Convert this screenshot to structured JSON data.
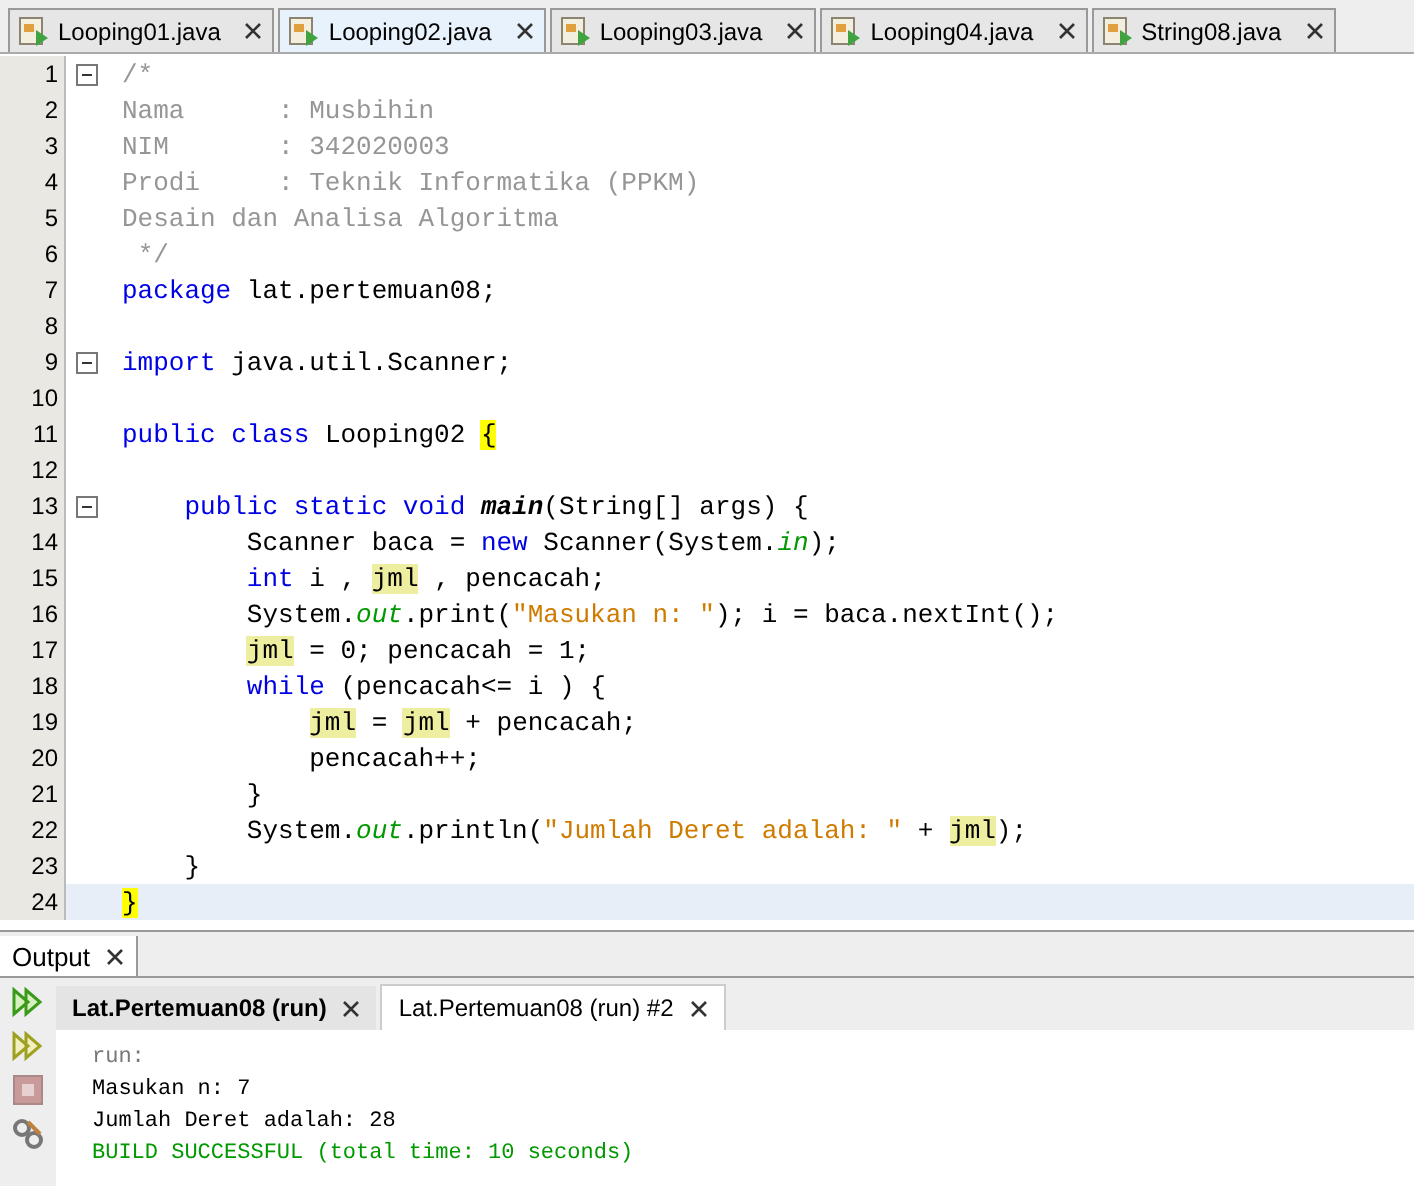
{
  "editor_tabs": [
    {
      "label": "Looping01.java",
      "selected": false
    },
    {
      "label": "Looping02.java",
      "selected": true
    },
    {
      "label": "Looping03.java",
      "selected": false
    },
    {
      "label": "Looping04.java",
      "selected": false
    },
    {
      "label": "String08.java",
      "selected": false
    }
  ],
  "code_lines": [
    {
      "number": "1",
      "fold": true,
      "current": false,
      "tokens": [
        {
          "kind": "comment",
          "t": "/*"
        }
      ]
    },
    {
      "number": "2",
      "fold": false,
      "current": false,
      "tokens": [
        {
          "kind": "comment",
          "t": "Nama      : Musbihin"
        }
      ]
    },
    {
      "number": "3",
      "fold": false,
      "current": false,
      "tokens": [
        {
          "kind": "comment",
          "t": "NIM       : 342020003"
        }
      ]
    },
    {
      "number": "4",
      "fold": false,
      "current": false,
      "tokens": [
        {
          "kind": "comment",
          "t": "Prodi     : Teknik Informatika (PPKM)"
        }
      ]
    },
    {
      "number": "5",
      "fold": false,
      "current": false,
      "tokens": [
        {
          "kind": "comment",
          "t": "Desain dan Analisa Algoritma"
        }
      ]
    },
    {
      "number": "6",
      "fold": false,
      "current": false,
      "tokens": [
        {
          "kind": "comment",
          "t": " */"
        }
      ]
    },
    {
      "number": "7",
      "fold": false,
      "current": false,
      "tokens": [
        {
          "kind": "kw",
          "t": "package"
        },
        {
          "kind": "plain",
          "t": " lat.pertemuan08;"
        }
      ]
    },
    {
      "number": "8",
      "fold": false,
      "current": false
    },
    {
      "number": "9",
      "fold": true,
      "current": false,
      "tokens": [
        {
          "kind": "kw",
          "t": "import"
        },
        {
          "kind": "plain",
          "t": " java.util.Scanner;"
        }
      ]
    },
    {
      "number": "10",
      "fold": false,
      "current": false
    },
    {
      "number": "11",
      "fold": false,
      "current": false,
      "tokens": [
        {
          "kind": "kw",
          "t": "public class"
        },
        {
          "kind": "plain",
          "t": " Looping02 "
        },
        {
          "kind": "brace",
          "t": "{"
        }
      ]
    },
    {
      "number": "12",
      "fold": false,
      "current": false
    },
    {
      "number": "13",
      "fold": true,
      "current": false,
      "tokens": [
        {
          "kind": "kw",
          "t": "    public static void "
        },
        {
          "kind": "method",
          "t": "main"
        },
        {
          "kind": "plain",
          "t": "(String[] args) {"
        }
      ]
    },
    {
      "number": "14",
      "fold": false,
      "current": false,
      "tokens": [
        {
          "kind": "plain",
          "t": "        Scanner baca = "
        },
        {
          "kind": "kw",
          "t": "new"
        },
        {
          "kind": "plain",
          "t": " Scanner(System."
        },
        {
          "kind": "field",
          "t": "in"
        },
        {
          "kind": "plain",
          "t": ");"
        }
      ]
    },
    {
      "number": "15",
      "fold": false,
      "current": false,
      "tokens": [
        {
          "kind": "kw",
          "t": "        int"
        },
        {
          "kind": "plain",
          "t": " i , "
        },
        {
          "kind": "mark",
          "t": "jml"
        },
        {
          "kind": "plain",
          "t": " , pencacah;"
        }
      ]
    },
    {
      "number": "16",
      "fold": false,
      "current": false,
      "tokens": [
        {
          "kind": "plain",
          "t": "        System."
        },
        {
          "kind": "field",
          "t": "out"
        },
        {
          "kind": "plain",
          "t": ".print("
        },
        {
          "kind": "str",
          "t": "\"Masukan n: \""
        },
        {
          "kind": "plain",
          "t": "); i = baca.nextInt();"
        }
      ]
    },
    {
      "number": "17",
      "fold": false,
      "current": false,
      "tokens": [
        {
          "kind": "mark",
          "t": "        jml"
        },
        {
          "kind": "plain",
          "t": " = 0; pencacah = 1;"
        }
      ]
    },
    {
      "number": "18",
      "fold": false,
      "current": false,
      "tokens": [
        {
          "kind": "kw",
          "t": "        while"
        },
        {
          "kind": "plain",
          "t": " (pencacah<= i ) {"
        }
      ]
    },
    {
      "number": "19",
      "fold": false,
      "current": false,
      "tokens": [
        {
          "kind": "mark",
          "t": "            jml"
        },
        {
          "kind": "plain",
          "t": " = "
        },
        {
          "kind": "mark",
          "t": "jml"
        },
        {
          "kind": "plain",
          "t": " + pencacah;"
        }
      ]
    },
    {
      "number": "20",
      "fold": false,
      "current": false,
      "tokens": [
        {
          "kind": "plain",
          "t": "            pencacah++;"
        }
      ]
    },
    {
      "number": "21",
      "fold": false,
      "current": false,
      "tokens": [
        {
          "kind": "plain",
          "t": "        }"
        }
      ]
    },
    {
      "number": "22",
      "fold": false,
      "current": false,
      "tokens": [
        {
          "kind": "plain",
          "t": "        System."
        },
        {
          "kind": "field",
          "t": "out"
        },
        {
          "kind": "plain",
          "t": ".println("
        },
        {
          "kind": "str",
          "t": "\"Jumlah Deret adalah: \""
        },
        {
          "kind": "plain",
          "t": " + "
        },
        {
          "kind": "mark",
          "t": "jml"
        },
        {
          "kind": "plain",
          "t": ");"
        }
      ]
    },
    {
      "number": "23",
      "fold": false,
      "current": false,
      "tokens": [
        {
          "kind": "plain",
          "t": "    }"
        }
      ]
    },
    {
      "number": "24",
      "fold": false,
      "current": true,
      "tokens": [
        {
          "kind": "brace",
          "t": "}"
        }
      ]
    }
  ],
  "output": {
    "title": "Output",
    "tabs": [
      {
        "label": "Lat.Pertemuan08 (run)",
        "selected": false,
        "bold": true
      },
      {
        "label": "Lat.Pertemuan08 (run) #2",
        "selected": true,
        "bold": false
      }
    ],
    "lines": [
      {
        "kind": "meta",
        "text": "run:"
      },
      {
        "kind": "out",
        "text": "Masukan n: 7"
      },
      {
        "kind": "out",
        "text": "Jumlah Deret adalah: 28"
      },
      {
        "kind": "success",
        "text": "BUILD SUCCESSFUL (total time: 10 seconds)"
      }
    ]
  }
}
